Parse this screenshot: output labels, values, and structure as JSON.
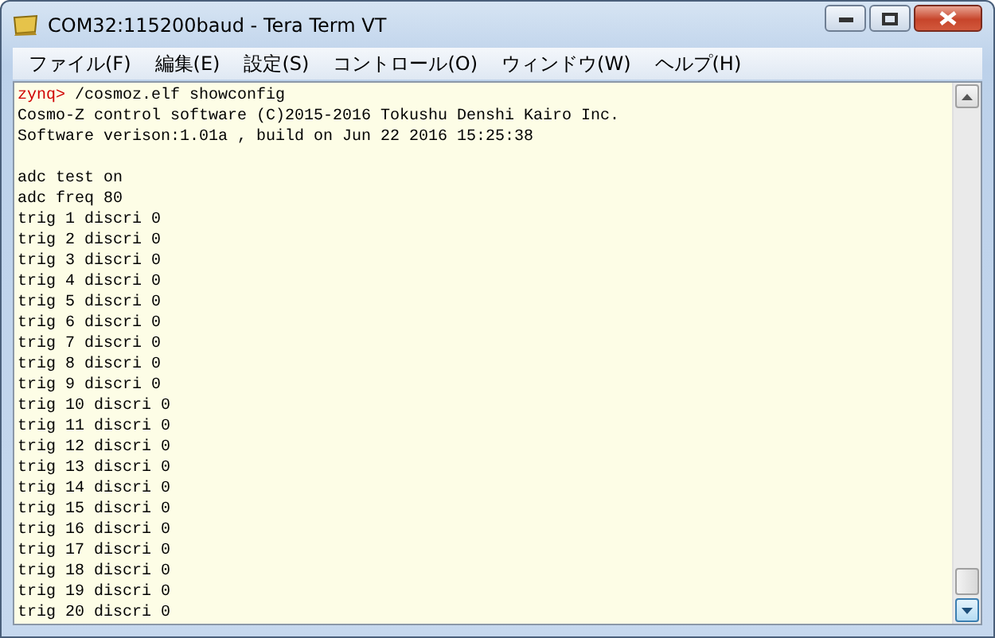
{
  "window": {
    "title": "COM32:115200baud - Tera Term VT"
  },
  "menu": [
    {
      "label": "ファイル(F)"
    },
    {
      "label": "編集(E)"
    },
    {
      "label": "設定(S)"
    },
    {
      "label": "コントロール(O)"
    },
    {
      "label": "ウィンドウ(W)"
    },
    {
      "label": "ヘルプ(H)"
    }
  ],
  "terminal": {
    "lines": [
      {
        "kind": "prompt",
        "prompt": "zynq>",
        "text": " /cosmoz.elf showconfig"
      },
      {
        "kind": "output",
        "text": "Cosmo-Z control software (C)2015-2016 Tokushu Denshi Kairo Inc."
      },
      {
        "kind": "output",
        "text": "Software verison:1.01a , build on Jun 22 2016 15:25:38"
      },
      {
        "kind": "blank"
      },
      {
        "kind": "output",
        "text": "adc test on"
      },
      {
        "kind": "output",
        "text": "adc freq 80"
      },
      {
        "kind": "output",
        "text": "trig 1 discri 0"
      },
      {
        "kind": "output",
        "text": "trig 2 discri 0"
      },
      {
        "kind": "output",
        "text": "trig 3 discri 0"
      },
      {
        "kind": "output",
        "text": "trig 4 discri 0"
      },
      {
        "kind": "output",
        "text": "trig 5 discri 0"
      },
      {
        "kind": "output",
        "text": "trig 6 discri 0"
      },
      {
        "kind": "output",
        "text": "trig 7 discri 0"
      },
      {
        "kind": "output",
        "text": "trig 8 discri 0"
      },
      {
        "kind": "output",
        "text": "trig 9 discri 0"
      },
      {
        "kind": "output",
        "text": "trig 10 discri 0"
      },
      {
        "kind": "output",
        "text": "trig 11 discri 0"
      },
      {
        "kind": "output",
        "text": "trig 12 discri 0"
      },
      {
        "kind": "output",
        "text": "trig 13 discri 0"
      },
      {
        "kind": "output",
        "text": "trig 14 discri 0"
      },
      {
        "kind": "output",
        "text": "trig 15 discri 0"
      },
      {
        "kind": "output",
        "text": "trig 16 discri 0"
      },
      {
        "kind": "output",
        "text": "trig 17 discri 0"
      },
      {
        "kind": "output",
        "text": "trig 18 discri 0"
      },
      {
        "kind": "output",
        "text": "trig 19 discri 0"
      },
      {
        "kind": "output",
        "text": "trig 20 discri 0"
      }
    ]
  }
}
